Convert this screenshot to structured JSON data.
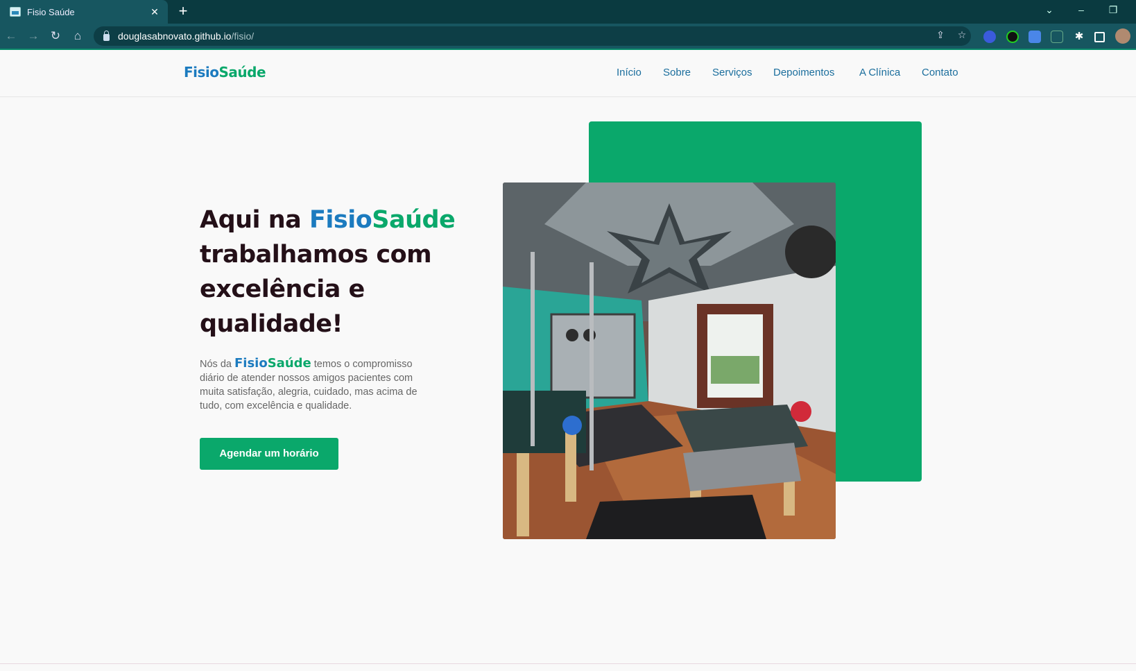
{
  "browser": {
    "tab_title": "Fisio Saúde",
    "tab_close": "✕",
    "new_tab": "+",
    "url_host": "douglasabnovato.github.io",
    "url_path": "/fisio/"
  },
  "site": {
    "logo_part1": "Fisio",
    "logo_part2": "Saúde",
    "nav": [
      "Início",
      "Sobre",
      "Serviços",
      "Depoimentos",
      "A Clínica",
      "Contato"
    ]
  },
  "hero": {
    "title_prefix": "Aqui na ",
    "title_brand1": "Fisio",
    "title_brand2": "Saúde",
    "title_rest": "trabalhamos com excelência e qualidade!",
    "desc_prefix": "Nós da ",
    "desc_brand1": "Fisio",
    "desc_brand2": "Saúde",
    "desc_rest": " temos o compromisso diário de atender nossos amigos pacientes com muita satisfação, alegria, cuidado, mas acima de tudo, com excelência e qualidade.",
    "cta_label": "Agendar um horário"
  },
  "colors": {
    "brand_blue": "#1c7bbf",
    "brand_green": "#0aa86b",
    "heading": "#241018",
    "chrome_dark": "#0a3a40"
  }
}
